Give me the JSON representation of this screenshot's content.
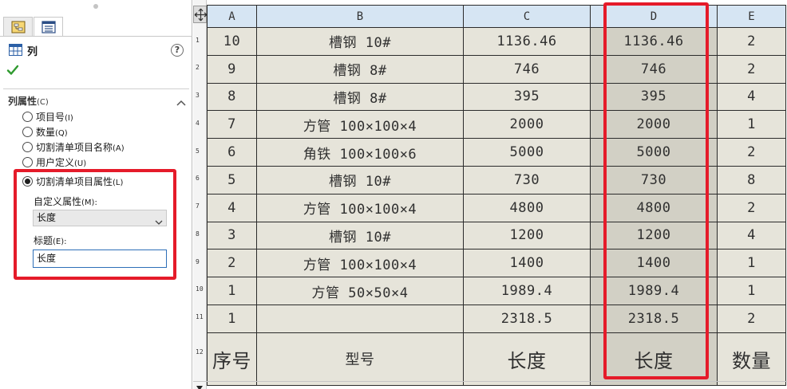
{
  "panel": {
    "title": "列",
    "section_title": "列属性",
    "section_key": "(C)",
    "options": [
      {
        "label": "项目号",
        "key": "(I)",
        "selected": false
      },
      {
        "label": "数量",
        "key": "(Q)",
        "selected": false
      },
      {
        "label": "切割清单项目名称",
        "key": "(A)",
        "selected": false
      },
      {
        "label": "用户定义",
        "key": "(U)",
        "selected": false
      },
      {
        "label": "切割清单项目属性",
        "key": "(L)",
        "selected": true
      }
    ],
    "custom_property_label": "自定义属性",
    "custom_property_key": "(M):",
    "custom_property_value": "长度",
    "caption_label": "标题",
    "caption_key": "(E):",
    "caption_value": "长度",
    "highlight_color": "#e51b2a"
  },
  "table": {
    "column_letters": [
      "A",
      "B",
      "C",
      "D",
      "E"
    ],
    "selected_column": "D",
    "rows": [
      {
        "gutter": "1",
        "item": "10",
        "model": "槽钢 10#",
        "length": "1136.46",
        "length_d": "1136.46",
        "qty": "2"
      },
      {
        "gutter": "2",
        "item": "9",
        "model": "槽钢 8#",
        "length": "746",
        "length_d": "746",
        "qty": "2"
      },
      {
        "gutter": "3",
        "item": "8",
        "model": "槽钢 8#",
        "length": "395",
        "length_d": "395",
        "qty": "4"
      },
      {
        "gutter": "4",
        "item": "7",
        "model": "方管 100×100×4",
        "length": "2000",
        "length_d": "2000",
        "qty": "1"
      },
      {
        "gutter": "5",
        "item": "6",
        "model": "角铁 100×100×6",
        "length": "5000",
        "length_d": "5000",
        "qty": "2"
      },
      {
        "gutter": "6",
        "item": "5",
        "model": "槽钢 10#",
        "length": "730",
        "length_d": "730",
        "qty": "8"
      },
      {
        "gutter": "7",
        "item": "4",
        "model": "方管 100×100×4",
        "length": "4800",
        "length_d": "4800",
        "qty": "2"
      },
      {
        "gutter": "8",
        "item": "3",
        "model": "槽钢 10#",
        "length": "1200",
        "length_d": "1200",
        "qty": "4"
      },
      {
        "gutter": "9",
        "item": "2",
        "model": "方管 100×100×4",
        "length": "1400",
        "length_d": "1400",
        "qty": "1"
      },
      {
        "gutter": "10",
        "item": "1",
        "model": "方管 50×50×4",
        "length": "1989.4",
        "length_d": "1989.4",
        "qty": "1"
      },
      {
        "gutter": "11",
        "item": "1",
        "model": "",
        "length": "2318.5",
        "length_d": "2318.5",
        "qty": "2"
      }
    ],
    "header_row": {
      "gutter": "12",
      "item": "序号",
      "model": "型号",
      "length": "长度",
      "length_d": "长度",
      "qty": "数量"
    },
    "colors": {
      "header_bg": "#d6e5f3",
      "cell_bg": "#e6e4da",
      "selected_bg": "#d2d0c5"
    }
  }
}
